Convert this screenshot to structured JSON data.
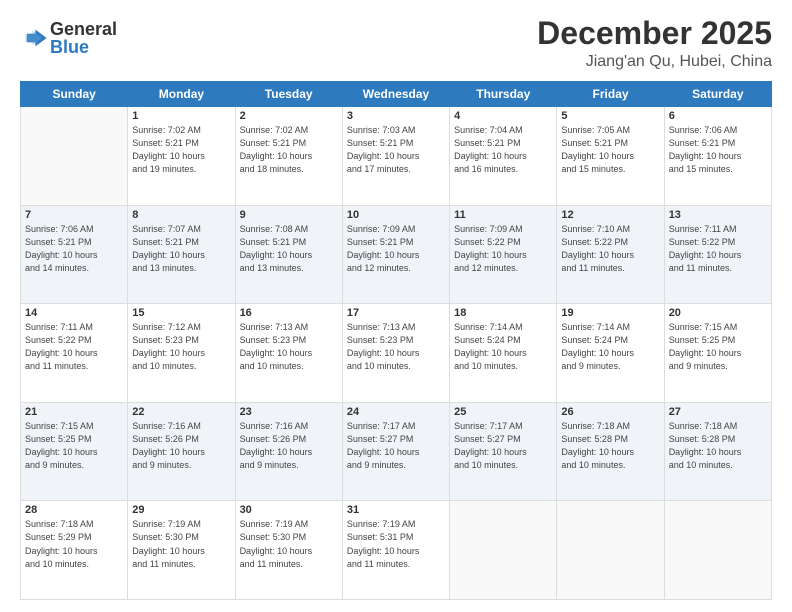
{
  "logo": {
    "general": "General",
    "blue": "Blue"
  },
  "header": {
    "month": "December 2025",
    "location": "Jiang'an Qu, Hubei, China"
  },
  "weekdays": [
    "Sunday",
    "Monday",
    "Tuesday",
    "Wednesday",
    "Thursday",
    "Friday",
    "Saturday"
  ],
  "weeks": [
    [
      {
        "day": "",
        "info": ""
      },
      {
        "day": "1",
        "info": "Sunrise: 7:02 AM\nSunset: 5:21 PM\nDaylight: 10 hours\nand 19 minutes."
      },
      {
        "day": "2",
        "info": "Sunrise: 7:02 AM\nSunset: 5:21 PM\nDaylight: 10 hours\nand 18 minutes."
      },
      {
        "day": "3",
        "info": "Sunrise: 7:03 AM\nSunset: 5:21 PM\nDaylight: 10 hours\nand 17 minutes."
      },
      {
        "day": "4",
        "info": "Sunrise: 7:04 AM\nSunset: 5:21 PM\nDaylight: 10 hours\nand 16 minutes."
      },
      {
        "day": "5",
        "info": "Sunrise: 7:05 AM\nSunset: 5:21 PM\nDaylight: 10 hours\nand 15 minutes."
      },
      {
        "day": "6",
        "info": "Sunrise: 7:06 AM\nSunset: 5:21 PM\nDaylight: 10 hours\nand 15 minutes."
      }
    ],
    [
      {
        "day": "7",
        "info": "Sunrise: 7:06 AM\nSunset: 5:21 PM\nDaylight: 10 hours\nand 14 minutes."
      },
      {
        "day": "8",
        "info": "Sunrise: 7:07 AM\nSunset: 5:21 PM\nDaylight: 10 hours\nand 13 minutes."
      },
      {
        "day": "9",
        "info": "Sunrise: 7:08 AM\nSunset: 5:21 PM\nDaylight: 10 hours\nand 13 minutes."
      },
      {
        "day": "10",
        "info": "Sunrise: 7:09 AM\nSunset: 5:21 PM\nDaylight: 10 hours\nand 12 minutes."
      },
      {
        "day": "11",
        "info": "Sunrise: 7:09 AM\nSunset: 5:22 PM\nDaylight: 10 hours\nand 12 minutes."
      },
      {
        "day": "12",
        "info": "Sunrise: 7:10 AM\nSunset: 5:22 PM\nDaylight: 10 hours\nand 11 minutes."
      },
      {
        "day": "13",
        "info": "Sunrise: 7:11 AM\nSunset: 5:22 PM\nDaylight: 10 hours\nand 11 minutes."
      }
    ],
    [
      {
        "day": "14",
        "info": "Sunrise: 7:11 AM\nSunset: 5:22 PM\nDaylight: 10 hours\nand 11 minutes."
      },
      {
        "day": "15",
        "info": "Sunrise: 7:12 AM\nSunset: 5:23 PM\nDaylight: 10 hours\nand 10 minutes."
      },
      {
        "day": "16",
        "info": "Sunrise: 7:13 AM\nSunset: 5:23 PM\nDaylight: 10 hours\nand 10 minutes."
      },
      {
        "day": "17",
        "info": "Sunrise: 7:13 AM\nSunset: 5:23 PM\nDaylight: 10 hours\nand 10 minutes."
      },
      {
        "day": "18",
        "info": "Sunrise: 7:14 AM\nSunset: 5:24 PM\nDaylight: 10 hours\nand 10 minutes."
      },
      {
        "day": "19",
        "info": "Sunrise: 7:14 AM\nSunset: 5:24 PM\nDaylight: 10 hours\nand 9 minutes."
      },
      {
        "day": "20",
        "info": "Sunrise: 7:15 AM\nSunset: 5:25 PM\nDaylight: 10 hours\nand 9 minutes."
      }
    ],
    [
      {
        "day": "21",
        "info": "Sunrise: 7:15 AM\nSunset: 5:25 PM\nDaylight: 10 hours\nand 9 minutes."
      },
      {
        "day": "22",
        "info": "Sunrise: 7:16 AM\nSunset: 5:26 PM\nDaylight: 10 hours\nand 9 minutes."
      },
      {
        "day": "23",
        "info": "Sunrise: 7:16 AM\nSunset: 5:26 PM\nDaylight: 10 hours\nand 9 minutes."
      },
      {
        "day": "24",
        "info": "Sunrise: 7:17 AM\nSunset: 5:27 PM\nDaylight: 10 hours\nand 9 minutes."
      },
      {
        "day": "25",
        "info": "Sunrise: 7:17 AM\nSunset: 5:27 PM\nDaylight: 10 hours\nand 10 minutes."
      },
      {
        "day": "26",
        "info": "Sunrise: 7:18 AM\nSunset: 5:28 PM\nDaylight: 10 hours\nand 10 minutes."
      },
      {
        "day": "27",
        "info": "Sunrise: 7:18 AM\nSunset: 5:28 PM\nDaylight: 10 hours\nand 10 minutes."
      }
    ],
    [
      {
        "day": "28",
        "info": "Sunrise: 7:18 AM\nSunset: 5:29 PM\nDaylight: 10 hours\nand 10 minutes."
      },
      {
        "day": "29",
        "info": "Sunrise: 7:19 AM\nSunset: 5:30 PM\nDaylight: 10 hours\nand 11 minutes."
      },
      {
        "day": "30",
        "info": "Sunrise: 7:19 AM\nSunset: 5:30 PM\nDaylight: 10 hours\nand 11 minutes."
      },
      {
        "day": "31",
        "info": "Sunrise: 7:19 AM\nSunset: 5:31 PM\nDaylight: 10 hours\nand 11 minutes."
      },
      {
        "day": "",
        "info": ""
      },
      {
        "day": "",
        "info": ""
      },
      {
        "day": "",
        "info": ""
      }
    ]
  ]
}
